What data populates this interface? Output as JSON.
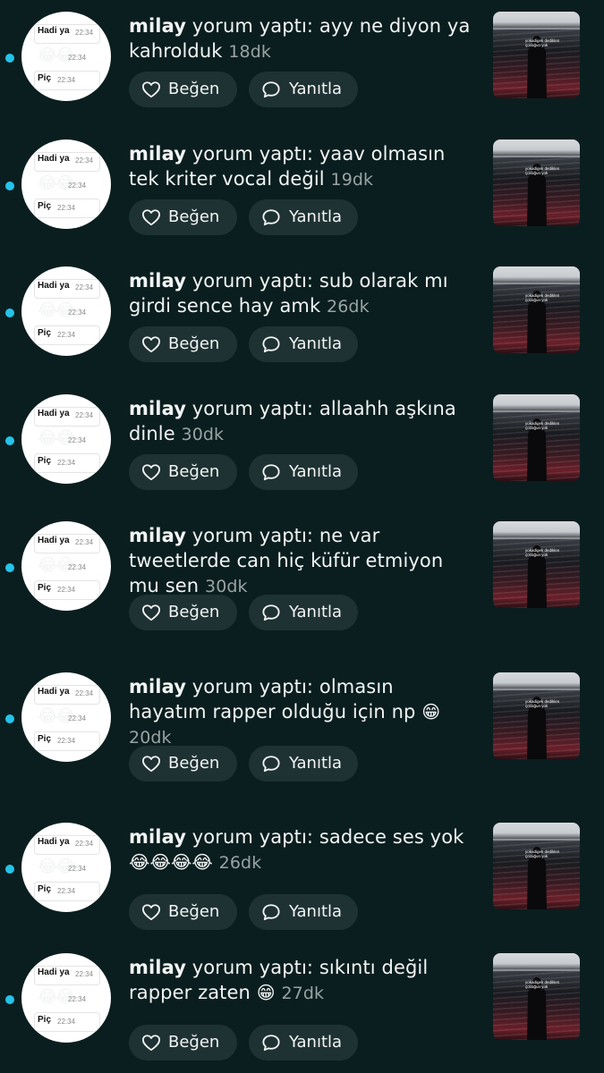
{
  "avatar": {
    "top_text": "Hadi ya",
    "time": "22:34",
    "emoji": "😂😂",
    "bottom_text": "Piç"
  },
  "thumbnail": {
    "caption": "yokadigek dediklen çocuğun yok"
  },
  "actions": {
    "like_label": "Beğen",
    "reply_label": "Yanıtla"
  },
  "colors": {
    "background": "#0b1e1f",
    "unread_dot": "#25c3ea",
    "button_bg": "#1f3233",
    "age_text": "#9aa3a3"
  },
  "notifications": [
    {
      "user": "milay",
      "action": "yorum yaptı:",
      "lines": [
        "ayy ne diyon ya",
        "kahrolduk"
      ],
      "emoji": "",
      "age": "18dk"
    },
    {
      "user": "milay",
      "action": "yorum yaptı:",
      "lines": [
        "yaav olmasın",
        "tek kriter vocal değil"
      ],
      "emoji": "",
      "age": "19dk"
    },
    {
      "user": "milay",
      "action": "yorum yaptı:",
      "lines": [
        "sub olarak mı",
        "girdi sence hay amk"
      ],
      "emoji": "",
      "age": "26dk"
    },
    {
      "user": "milay",
      "action": "yorum yaptı:",
      "lines": [
        "allaahh aşkına",
        "dinle"
      ],
      "emoji": "",
      "age": "30dk"
    },
    {
      "user": "milay",
      "action": "yorum yaptı:",
      "lines": [
        "ne var",
        "tweetlerde can hiç küfür etmiyon",
        "mu sen"
      ],
      "emoji": "",
      "age": "30dk"
    },
    {
      "user": "milay",
      "action": "yorum yaptı:",
      "lines": [
        "olmasın",
        "hayatım rapper olduğu için np"
      ],
      "emoji": "😁",
      "age": "20dk"
    },
    {
      "user": "milay",
      "action": "yorum yaptı:",
      "lines": [
        "sadece ses yok",
        ""
      ],
      "emoji": "😂😂😂😂",
      "age": "26dk"
    },
    {
      "user": "milay",
      "action": "yorum yaptı:",
      "lines": [
        "sıkıntı değil",
        "rapper zaten"
      ],
      "emoji": "😁",
      "age": "27dk"
    }
  ]
}
